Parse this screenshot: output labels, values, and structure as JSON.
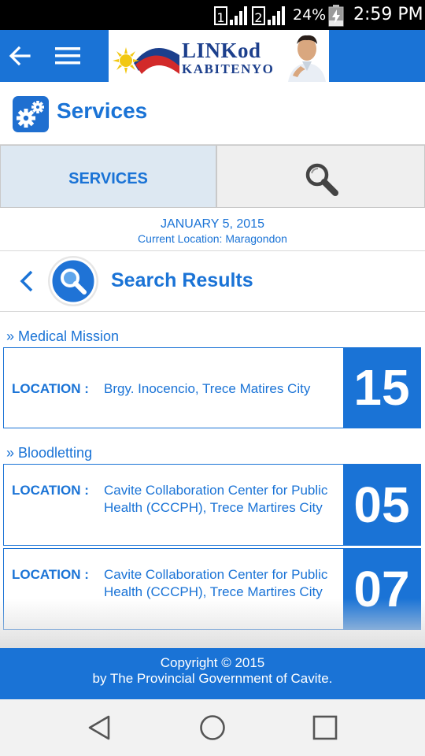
{
  "status_bar": {
    "battery_percent": "24%",
    "time": "2:59 PM",
    "sim_indicators": [
      "1",
      "2"
    ]
  },
  "app_bar": {
    "brand_line1": "LINKod",
    "brand_line2": "KABITENYO",
    "back_icon": "arrow-left-icon",
    "menu_icon": "hamburger-icon"
  },
  "page": {
    "title": "Services",
    "icon": "gears-icon"
  },
  "tabs": [
    {
      "label": "SERVICES",
      "selected": true
    },
    {
      "icon": "search-icon",
      "selected": false
    }
  ],
  "date_block": {
    "date": "JANUARY 5, 2015",
    "location": "Current Location: Maragondon"
  },
  "results": {
    "title": "Search Results",
    "groups": [
      {
        "category": "» Medical Mission",
        "items": [
          {
            "label": "LOCATION :",
            "location": "Brgy. Inocencio, Trece Matires City",
            "day": "15"
          }
        ]
      },
      {
        "category": "» Bloodletting",
        "items": [
          {
            "label": "LOCATION :",
            "location": "Cavite Collaboration Center for Public Health (CCCPH), Trece Martires City",
            "day": "05"
          },
          {
            "label": "LOCATION :",
            "location": "Cavite Collaboration Center for Public Health (CCCPH), Trece Martires City",
            "day": "07"
          }
        ]
      }
    ]
  },
  "footer": {
    "line1": "Copyright © 2015",
    "line2": "by The Provincial Government of Cavite."
  },
  "colors": {
    "primary": "#1a73d6",
    "tab_selected_bg": "#dde8f2"
  }
}
